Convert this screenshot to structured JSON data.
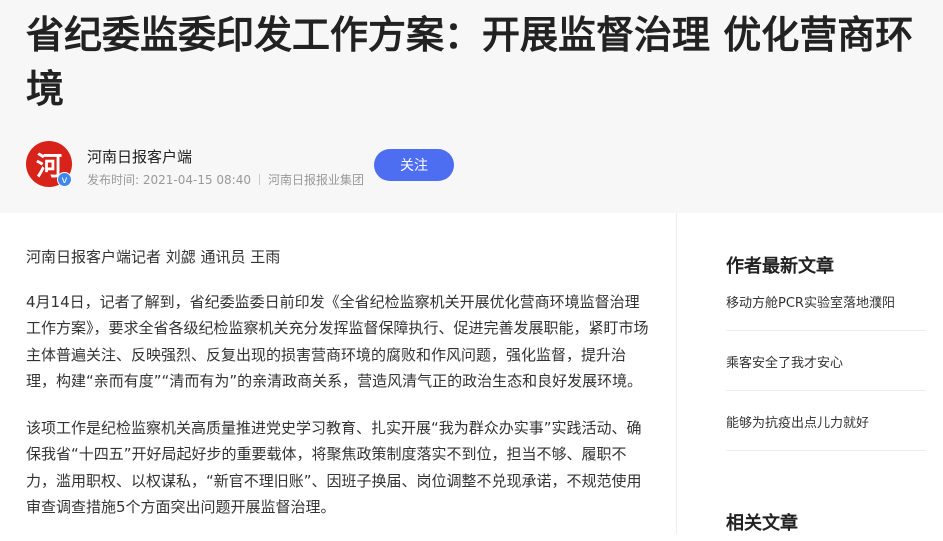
{
  "article": {
    "title": "省纪委监委印发工作方案：开展监督治理 优化营商环境",
    "author": {
      "avatar_char": "河",
      "name": "河南日报客户端",
      "publish_time": "发布时间: 2021-04-15 08:40",
      "publisher": "河南日报报业集团",
      "verified_mark": "v"
    },
    "follow_label": "关注",
    "byline": "河南日报客户端记者 刘勰 通讯员 王雨",
    "paragraphs": [
      "4月14日，记者了解到，省纪委监委日前印发《全省纪检监察机关开展优化营商环境监督治理工作方案》，要求全省各级纪检监察机关充分发挥监督保障执行、促进完善发展职能，紧盯市场主体普遍关注、反映强烈、反复出现的损害营商环境的腐败和作风问题，强化监督，提升治理，构建“亲而有度”“清而有为”的亲清政商关系，营造风清气正的政治生态和良好发展环境。",
      "该项工作是纪检监察机关高质量推进党史学习教育、扎实开展“我为群众办实事”实践活动、确保我省“十四五”开好局起好步的重要载体，将聚焦政策制度落实不到位，担当不够、履职不力，滥用职权、以权谋私，“新官不理旧账”、因班子换届、岗位调整不兑现承诺，不规范使用审查调查措施5个方面突出问题开展监督治理。"
    ]
  },
  "sidebar": {
    "latest_heading": "作者最新文章",
    "latest_items": [
      "移动方舱PCR实验室落地濮阳",
      "乘客安全了我才安心",
      "能够为抗疫出点儿力就好"
    ],
    "related_heading": "相关文章"
  }
}
